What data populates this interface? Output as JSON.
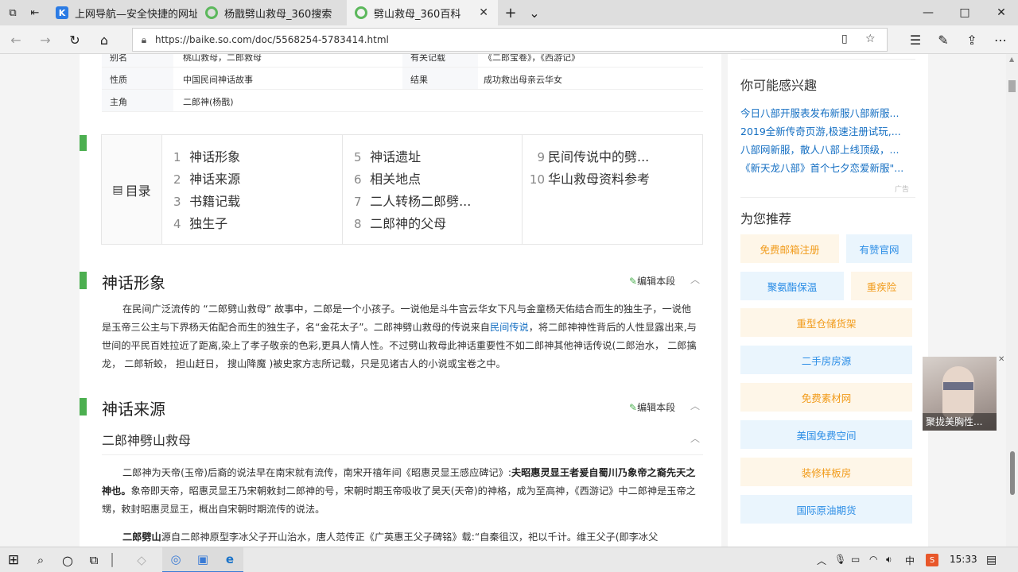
{
  "tabs": [
    {
      "title": "上网导航—安全快捷的网址",
      "favicon": "K"
    },
    {
      "title": "杨戬劈山救母_360搜索",
      "favicon": "360"
    },
    {
      "title": "劈山救母_360百科",
      "favicon": "360"
    }
  ],
  "tab_close": "✕",
  "new_tab": "+",
  "tab_list": "⌄",
  "window": {
    "minimize": "—",
    "maximize": "□",
    "close": "✕"
  },
  "address": {
    "url": "https://baike.so.com/doc/5568254-5783414.html"
  },
  "info_rows": [
    {
      "k1": "别名",
      "v1": "桃山救母，二郎救母",
      "k2": "有关记载",
      "v2": "《二郎宝卷》，《西游记》"
    },
    {
      "k1": "性质",
      "v1": "中国民间神话故事",
      "k2": "结果",
      "v2": "成功救出母亲云华女"
    },
    {
      "k1": "主角",
      "v1": "二郎神(杨戬)",
      "k2": "",
      "v2": ""
    }
  ],
  "toc": {
    "title": "目录",
    "col1": [
      {
        "num": "1",
        "label": "神话形象"
      },
      {
        "num": "2",
        "label": "神话来源"
      },
      {
        "num": "3",
        "label": "书籍记载"
      },
      {
        "num": "4",
        "label": "独生子"
      }
    ],
    "col2": [
      {
        "num": "5",
        "label": "神话遗址"
      },
      {
        "num": "6",
        "label": "相关地点"
      },
      {
        "num": "7",
        "label": "二人转杨二郎劈..."
      },
      {
        "num": "8",
        "label": "二郎神的父母"
      }
    ],
    "col3": [
      {
        "num": "9",
        "label": "民间传说中的劈..."
      },
      {
        "num": "10",
        "label": "华山救母资料参考"
      }
    ]
  },
  "edit_label": "编辑本段",
  "section1": {
    "title": "神话形象",
    "para_a": "在民间广泛流传的 “二郎劈山救母” 故事中，二郎是一个小孩子。一说他是斗牛宫云华女下凡与金童杨天佑结合而生的独生子，一说他是玉帝三公主与下界杨天佑配合而生的独生子，名“金花太子”。二郎神劈山救母的传说来自",
    "para_link": "民间传说",
    "para_b": "，将二郎神神性背后的人性显露出来,与世间的平民百姓拉近了距离,染上了孝子敬亲的色彩,更具人情人性。不过劈山救母此神话重要性不如二郎神其他神话传说(二郎治水， 二郎擒龙， 二郎斩蛟， 担山赶日， 搜山降魔 )被史家方志所记载，只是见诸古人的小说或宝卷之中。"
  },
  "section2": {
    "title": "神话来源",
    "subtitle": "二郎神劈山救母",
    "p1_a": "二郎神为天帝(玉帝)后裔的说法早在南宋就有流传，南宋开禧年间《昭惠灵显王感应碑记》:",
    "p1_bold": "夫昭惠灵显王者爰自蜀川乃象帝之裔先天之神也。",
    "p1_b": "象帝即天帝，昭惠灵显王乃宋朝敕封二郎神的号，宋朝时期玉帝吸收了昊天(天帝)的神格，成为至高神，《西游记》中二郎神是玉帝之甥，敕封昭惠灵显王，概出自宋朝时期流传的说法。",
    "p2_bold": "二郎劈山",
    "p2_a": "源自二郎神原型李冰父子开山治水，唐人范传正《广英惠王父子碑铭》载:“自秦徂汉，祀以千计。维王父子(即李冰父"
  },
  "sidebar": {
    "interest_title": "你可能感兴趣",
    "links": [
      "今日八部开服表发布新服八部新服...",
      "2019全新传奇页游,极速注册试玩,...",
      "八部网新服，散人八部上线顶级，...",
      "《新天龙八部》首个七夕恋爱新服\"..."
    ],
    "ad_tag": "广告",
    "recommend_title": "为您推荐",
    "tags": [
      {
        "label": "免费邮箱注册",
        "style": "y"
      },
      {
        "label": "有赞官网",
        "style": "b"
      },
      {
        "label": "聚氨酯保温",
        "style": "b"
      },
      {
        "label": "重疾险",
        "style": "y"
      },
      {
        "label": "重型仓储货架",
        "style": "y"
      },
      {
        "label": "二手房房源",
        "style": "b"
      },
      {
        "label": "免费素材网",
        "style": "y"
      },
      {
        "label": "美国免费空间",
        "style": "b"
      },
      {
        "label": "装修样板房",
        "style": "y"
      },
      {
        "label": "国际原油期货",
        "style": "b"
      }
    ]
  },
  "float_ad": {
    "caption": "聚拢美胸性...",
    "close": "✕"
  },
  "taskbar": {
    "time": "15:33",
    "ime": "中",
    "app_badge": "S"
  },
  "colors": {
    "accent_green": "#4caf50",
    "link_blue": "#136ec2",
    "tag_orange": "#f19b1a",
    "tag_blue": "#2d8ee6"
  }
}
